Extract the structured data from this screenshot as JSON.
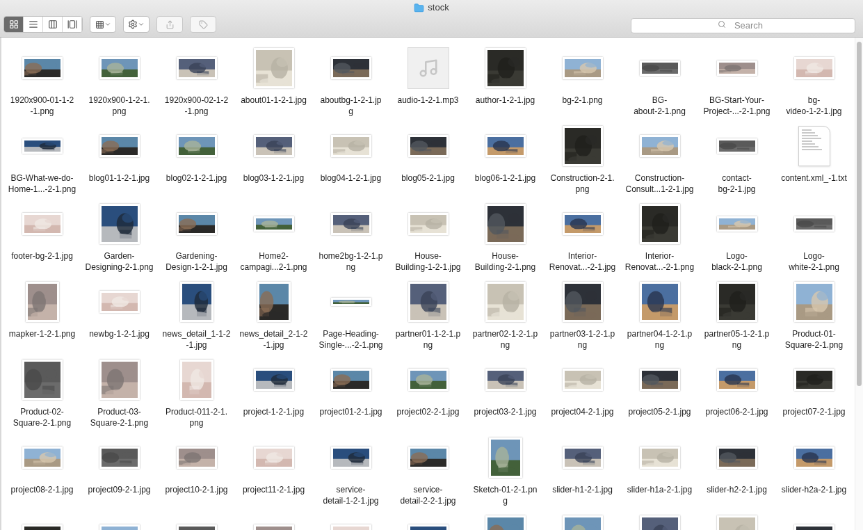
{
  "window": {
    "title": "stock"
  },
  "toolbar": {
    "view_modes": [
      {
        "kind": "icons",
        "selected": true
      },
      {
        "kind": "list",
        "selected": false
      },
      {
        "kind": "columns",
        "selected": false
      },
      {
        "kind": "gallery",
        "selected": false
      }
    ]
  },
  "search": {
    "placeholder": "Search"
  },
  "files": [
    {
      "name": "1920x900-01-1-2\n-1.png",
      "kind": "photo-wide"
    },
    {
      "name": "1920x900-1-2-1.\npng",
      "kind": "photo-wide"
    },
    {
      "name": "1920x900-02-1-2\n-1.png",
      "kind": "photo-wide"
    },
    {
      "name": "about01-1-2-1.jpg",
      "kind": "photo-square"
    },
    {
      "name": "aboutbg-1-2-1.jp\ng",
      "kind": "photo-wide"
    },
    {
      "name": "audio-1-2-1.mp3",
      "kind": "audio"
    },
    {
      "name": "author-1-2-1.jpg",
      "kind": "photo-square"
    },
    {
      "name": "bg-2-1.png",
      "kind": "photo-wide"
    },
    {
      "name": "BG-\nabout-2-1.png",
      "kind": "photo-strip"
    },
    {
      "name": "BG-Start-Your-\nProject-...-2-1.png",
      "kind": "photo-strip"
    },
    {
      "name": "bg-\nvideo-1-2-1.jpg",
      "kind": "photo-wide"
    },
    {
      "name": "BG-What-we-do-\nHome-1...-2-1.png",
      "kind": "photo-strip"
    },
    {
      "name": "blog01-1-2-1.jpg",
      "kind": "photo-wide"
    },
    {
      "name": "blog02-1-2-1.jpg",
      "kind": "photo-wide"
    },
    {
      "name": "blog03-1-2-1.jpg",
      "kind": "photo-wide"
    },
    {
      "name": "blog04-1-2-1.jpg",
      "kind": "photo-wide"
    },
    {
      "name": "blog05-2-1.jpg",
      "kind": "photo-wide"
    },
    {
      "name": "blog06-1-2-1.jpg",
      "kind": "photo-wide"
    },
    {
      "name": "Construction-2-1.\npng",
      "kind": "photo-square"
    },
    {
      "name": "Construction-\nConsult...1-2-1.jpg",
      "kind": "photo-wide"
    },
    {
      "name": "contact-\nbg-2-1.jpg",
      "kind": "photo-strip"
    },
    {
      "name": "content.xml_-1.txt",
      "kind": "text"
    },
    {
      "name": "footer-bg-2-1.jpg",
      "kind": "photo-wide"
    },
    {
      "name": "Garden-\nDesigning-2-1.png",
      "kind": "photo-square"
    },
    {
      "name": "Gardening-\nDesign-1-2-1.jpg",
      "kind": "photo-wide"
    },
    {
      "name": "Home2-\ncampagi...2-1.png",
      "kind": "photo-strip"
    },
    {
      "name": "home2bg-1-2-1.p\nng",
      "kind": "photo-wide"
    },
    {
      "name": "House-\nBuilding-1-2-1.jpg",
      "kind": "photo-wide"
    },
    {
      "name": "House-\nBuilding-2-1.png",
      "kind": "photo-square"
    },
    {
      "name": "Interior-\nRenovat...-2-1.jpg",
      "kind": "photo-wide"
    },
    {
      "name": "Interior-\nRenovat...-2-1.png",
      "kind": "photo-square"
    },
    {
      "name": "Logo-\nblack-2-1.png",
      "kind": "photo-strip"
    },
    {
      "name": "Logo-\nwhite-2-1.png",
      "kind": "photo-strip"
    },
    {
      "name": "mapker-1-2-1.png",
      "kind": "photo-tall"
    },
    {
      "name": "newbg-1-2-1.jpg",
      "kind": "photo-wide"
    },
    {
      "name": "news_detail_1-1-2\n-1.jpg",
      "kind": "photo-tall"
    },
    {
      "name": "news_detail_2-1-2\n-1.jpg",
      "kind": "photo-tall"
    },
    {
      "name": "Page-Heading-\nSingle-...-2-1.png",
      "kind": "photo-banner"
    },
    {
      "name": "partner01-1-2-1.p\nng",
      "kind": "photo-square"
    },
    {
      "name": "partner02-1-2-1.p\nng",
      "kind": "photo-square"
    },
    {
      "name": "partner03-1-2-1.p\nng",
      "kind": "photo-square"
    },
    {
      "name": "partner04-1-2-1.p\nng",
      "kind": "photo-square"
    },
    {
      "name": "partner05-1-2-1.p\nng",
      "kind": "photo-square"
    },
    {
      "name": "Product-01-\nSquare-2-1.png",
      "kind": "photo-square"
    },
    {
      "name": "Product-02-\nSquare-2-1.png",
      "kind": "photo-square"
    },
    {
      "name": "Product-03-\nSquare-2-1.png",
      "kind": "photo-square"
    },
    {
      "name": "Product-011-2-1.\npng",
      "kind": "photo-tall"
    },
    {
      "name": "project-1-2-1.jpg",
      "kind": "photo-wide"
    },
    {
      "name": "project01-2-1.jpg",
      "kind": "photo-wide"
    },
    {
      "name": "project02-2-1.jpg",
      "kind": "photo-wide"
    },
    {
      "name": "project03-2-1.jpg",
      "kind": "photo-wide"
    },
    {
      "name": "project04-2-1.jpg",
      "kind": "photo-wide"
    },
    {
      "name": "project05-2-1.jpg",
      "kind": "photo-wide"
    },
    {
      "name": "project06-2-1.jpg",
      "kind": "photo-wide"
    },
    {
      "name": "project07-2-1.jpg",
      "kind": "photo-wide"
    },
    {
      "name": "project08-2-1.jpg",
      "kind": "photo-wide"
    },
    {
      "name": "project09-2-1.jpg",
      "kind": "photo-wide"
    },
    {
      "name": "project10-2-1.jpg",
      "kind": "photo-wide"
    },
    {
      "name": "project11-2-1.jpg",
      "kind": "photo-wide"
    },
    {
      "name": "service-\ndetail-1-2-1.jpg",
      "kind": "photo-wide"
    },
    {
      "name": "service-\ndetail-2-2-1.jpg",
      "kind": "photo-wide"
    },
    {
      "name": "Sketch-01-2-1.pn\ng",
      "kind": "photo-tall"
    },
    {
      "name": "slider-h1-2-1.jpg",
      "kind": "photo-wide"
    },
    {
      "name": "slider-h1a-2-1.jpg",
      "kind": "photo-wide"
    },
    {
      "name": "slider-h2-2-1.jpg",
      "kind": "photo-wide"
    },
    {
      "name": "slider-h2a-2-1.jpg",
      "kind": "photo-wide"
    },
    {
      "kind": "photo-wide"
    },
    {
      "kind": "photo-wide"
    },
    {
      "kind": "photo-wide"
    },
    {
      "kind": "photo-wide"
    },
    {
      "kind": "photo-wide"
    },
    {
      "kind": "photo-wide"
    },
    {
      "kind": "photo-square"
    },
    {
      "kind": "photo-square"
    },
    {
      "kind": "photo-square"
    },
    {
      "kind": "photo-square"
    },
    {
      "kind": "photo-wide"
    }
  ]
}
